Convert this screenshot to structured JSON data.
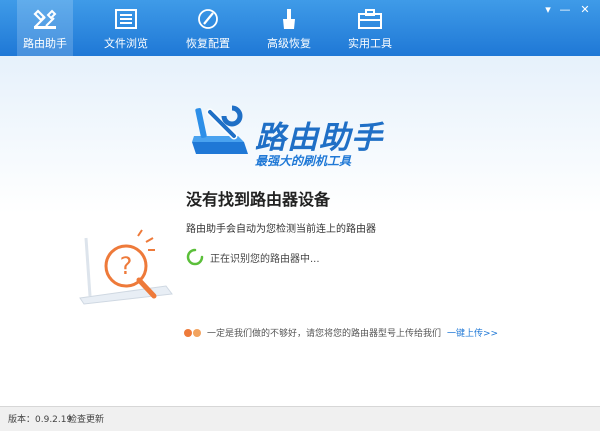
{
  "toolbar": {
    "tabs": [
      {
        "label": "路由助手",
        "icon": "router-tools-icon"
      },
      {
        "label": "文件浏览",
        "icon": "file-list-icon"
      },
      {
        "label": "恢复配置",
        "icon": "restore-pen-icon"
      },
      {
        "label": "高级恢复",
        "icon": "brush-icon"
      },
      {
        "label": "实用工具",
        "icon": "toolbox-icon"
      }
    ]
  },
  "window_controls": {
    "menu": "▾",
    "minimize": "—",
    "close": "✕"
  },
  "logo": {
    "title": "路由助手",
    "subtitle": "最强大的刷机工具"
  },
  "main": {
    "heading": "没有找到路由器设备",
    "description": "路由助手会自动为您检测当前连上的路由器",
    "status": "正在识别您的路由器中...",
    "hint": "一定是我们做的不够好，请您将您的路由器型号上传给我们",
    "hint_link": "一键上传>>"
  },
  "footer": {
    "version": "版本：0.9.2.19",
    "check_update": "检查更新"
  },
  "colors": {
    "accent": "#1f78d6",
    "toolbar": "#2a86de",
    "orange": "#ee7a3a",
    "spinner": "#5bbf3a"
  }
}
